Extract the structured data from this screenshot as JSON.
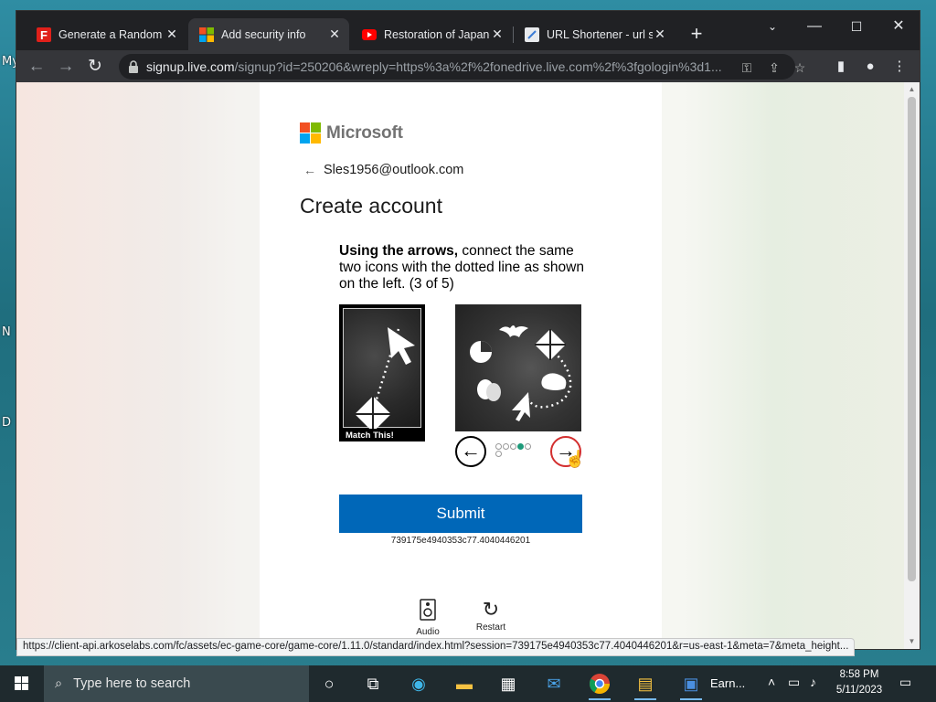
{
  "desktop": {
    "labels": [
      "My",
      "N",
      "D"
    ]
  },
  "browser": {
    "tabs": [
      {
        "title": "Generate a Random N",
        "favicon": "red-f-icon"
      },
      {
        "title": "Add security info",
        "favicon": "microsoft-icon",
        "active": true
      },
      {
        "title": "Restoration of Japanese",
        "favicon": "youtube-icon"
      },
      {
        "title": "URL Shortener - url sh",
        "favicon": "link-icon"
      }
    ],
    "new_tab_label": "+",
    "url_host": "signup.live.com",
    "url_path": "/signup?id=250206&wreply=https%3a%2f%2fonedrive.live.com%2f%3fgologin%3d1...",
    "status_url": "https://client-api.arkoselabs.com/fc/assets/ec-game-core/game-core/1.11.0/standard/index.html?session=739175e4940353c77.4040446201&r=us-east-1&meta=7&meta_height..."
  },
  "page": {
    "brand": "Microsoft",
    "identity_email": "Sles1956@outlook.com",
    "title": "Create account",
    "instructions_bold": "Using the arrows,",
    "instructions_rest": " connect the same two icons with the dotted line as shown on the left. (3 of 5)",
    "match_label": "Match This!",
    "prev_label": "←",
    "next_label": "→",
    "pager_current": 4,
    "pager_total": 6,
    "submit_label": "Submit",
    "session_id": "739175e4940353c77.4040446201",
    "audio_label": "Audio",
    "restart_label": "Restart"
  },
  "taskbar": {
    "search_placeholder": "Type here to search",
    "app_label": "Earn...",
    "time": "8:58 PM",
    "date": "5/11/2023"
  },
  "colors": {
    "ms_red": "#f25022",
    "ms_green": "#7fba00",
    "ms_blue": "#00a4ef",
    "ms_yellow": "#ffb900",
    "submit": "#0067b8"
  }
}
